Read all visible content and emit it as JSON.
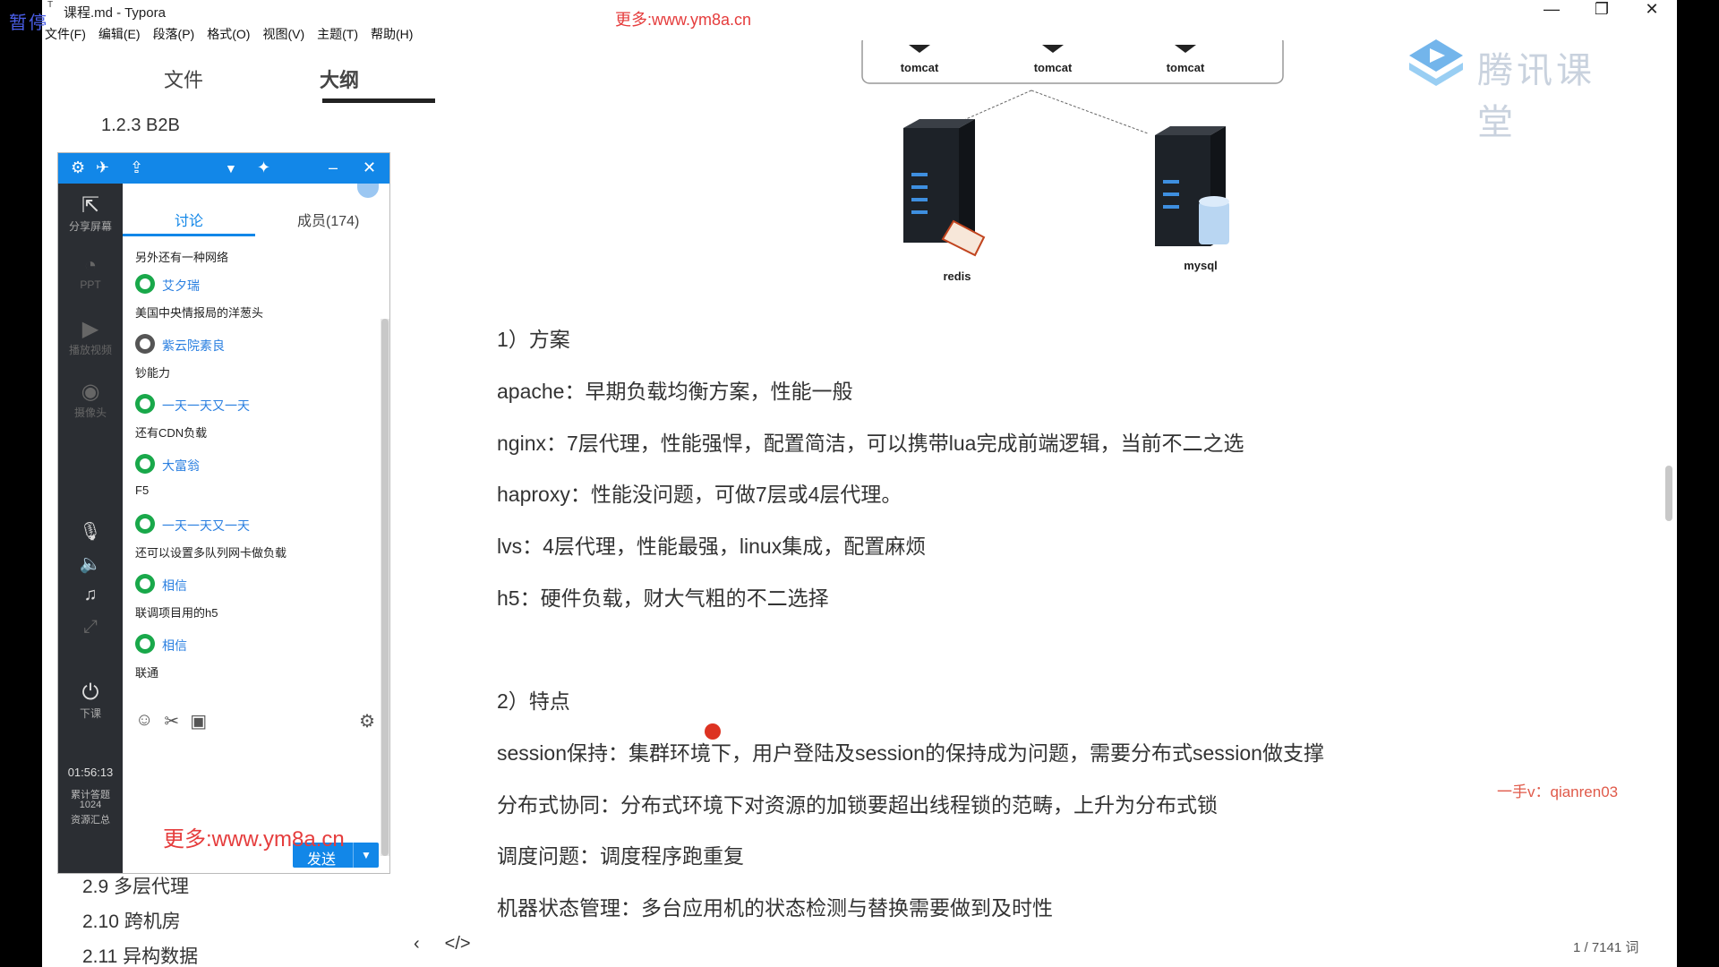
{
  "window": {
    "title": "课程.md - Typora",
    "overlay_status": "暂停",
    "watermark": "更多:www.ym8a.cn",
    "controls": [
      "—",
      "❐",
      "✕"
    ]
  },
  "menu": [
    "文件(F)",
    "编辑(E)",
    "段落(P)",
    "格式(O)",
    "视图(V)",
    "主题(T)",
    "帮助(H)"
  ],
  "sidebar": {
    "tabs": {
      "files": "文件",
      "outline": "大纲"
    },
    "outline_top": "1.2.3 B2B",
    "outline_bottom": [
      "2.9 多层代理",
      "2.10 跨机房",
      "2.11 异构数据"
    ]
  },
  "chat": {
    "tabs": {
      "discuss": "讨论",
      "members": "成员(174)"
    },
    "left_buttons": [
      {
        "label": "分享屏幕",
        "icon": "share-screen-icon"
      },
      {
        "label": "PPT",
        "icon": "ppt-icon"
      },
      {
        "label": "播放视频",
        "icon": "video-icon"
      },
      {
        "label": "摄像头",
        "icon": "camera-icon"
      },
      {
        "label": "下课",
        "icon": "end-class-icon"
      }
    ],
    "time": "01:56:13",
    "stat_label": "累计答题",
    "stat_value": "1024",
    "stat_label2": "资源汇总",
    "first_line": "另外还有一种网络",
    "messages": [
      {
        "name": "艾夕瑞",
        "text": "美国中央情报局的洋葱头"
      },
      {
        "name": "紫云院素良",
        "text": "钞能力"
      },
      {
        "name": "一天一天又一天",
        "text": "还有CDN负载"
      },
      {
        "name": "大富翁",
        "text": "F5"
      },
      {
        "name": "一天一天又一天",
        "text": "还可以设置多队列网卡做负载"
      },
      {
        "name": "相信",
        "text": "联调项目用的h5"
      },
      {
        "name": "相信",
        "text": "联通"
      }
    ],
    "send_label": "发送",
    "watermark": "更多:www.ym8a.cn"
  },
  "diagram": {
    "tomcats": [
      "tomcat",
      "tomcat",
      "tomcat"
    ],
    "servers": [
      "redis",
      "mysql"
    ]
  },
  "content": {
    "heading1": "1）方案",
    "solutions": [
      "apache：早期负载均衡方案，性能一般",
      "nginx：7层代理，性能强悍，配置简洁，可以携带lua完成前端逻辑，当前不二之选",
      "haproxy：性能没问题，可做7层或4层代理。",
      "lvs：4层代理，性能最强，linux集成，配置麻烦",
      "h5：硬件负载，财大气粗的不二选择"
    ],
    "heading2": "2）特点",
    "features": [
      "session保持：集群环境下，用户登陆及session的保持成为问题，需要分布式session做支撑",
      "分布式协同：分布式环境下对资源的加锁要超出线程锁的范畴，上升为分布式锁",
      "调度问题：调度程序跑重复",
      "机器状态管理：多台应用机的状态检测与替换需要做到及时性"
    ]
  },
  "brand": {
    "name": "腾讯课堂"
  },
  "contact": "一手v：qianren03",
  "footer": {
    "wordcount": "1 / 7141 词",
    "nav_back": "‹",
    "nav_code": "</>"
  }
}
